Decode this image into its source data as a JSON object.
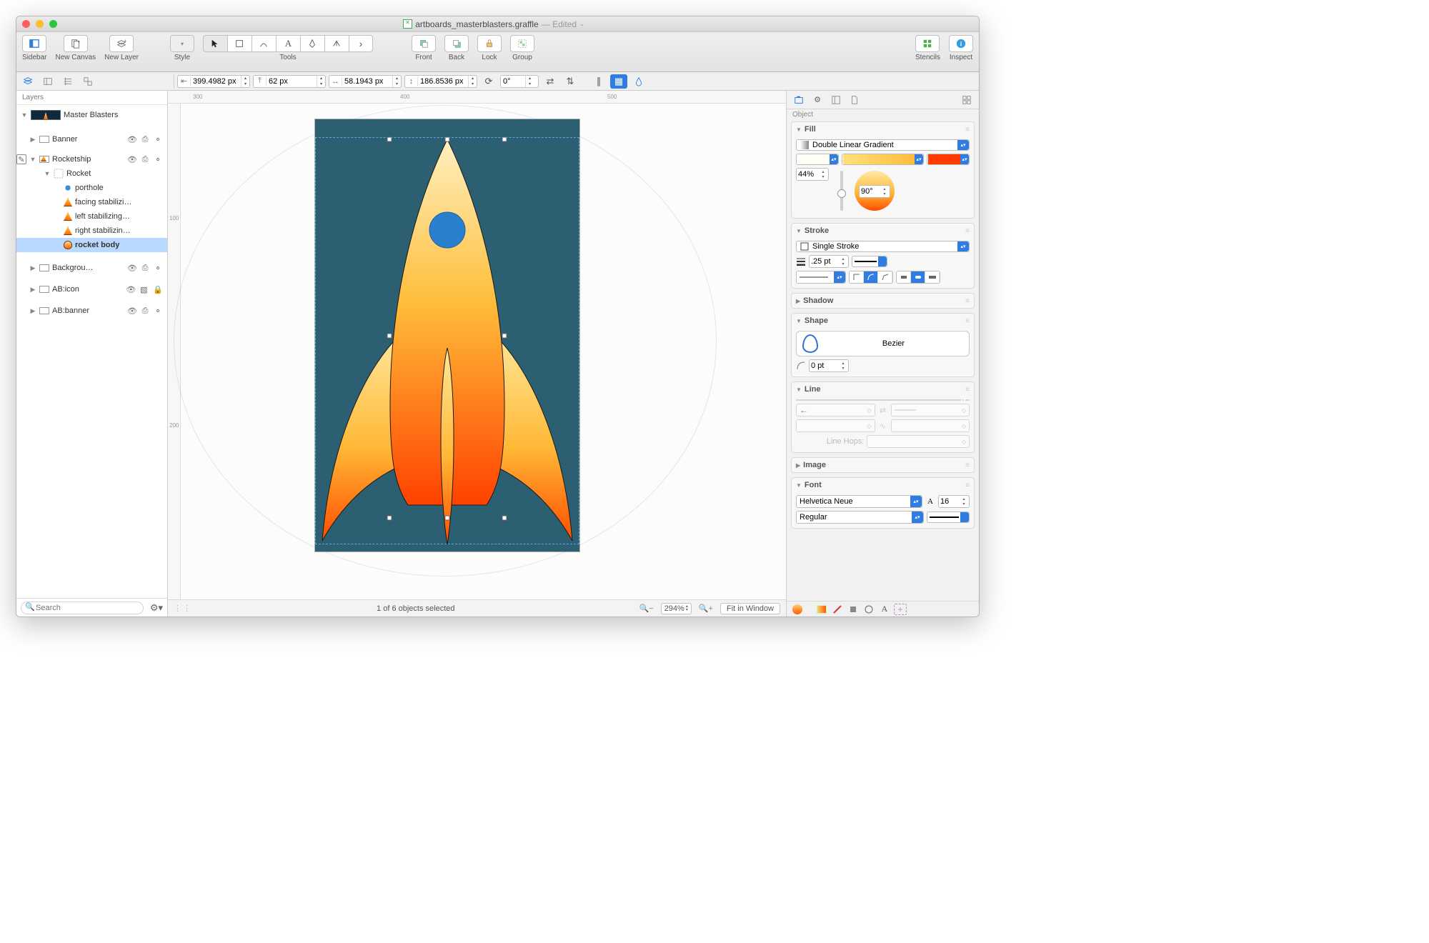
{
  "title": {
    "filename": "artboards_masterblasters.graffle",
    "status": "— Edited"
  },
  "toolbar": {
    "sidebar": "Sidebar",
    "new_canvas": "New Canvas",
    "new_layer": "New Layer",
    "style": "Style",
    "tools": "Tools",
    "front": "Front",
    "back": "Back",
    "lock": "Lock",
    "group": "Group",
    "stencils": "Stencils",
    "inspect": "Inspect"
  },
  "geom": {
    "x": "399.4982 px",
    "y": "62 px",
    "w": "58.1943 px",
    "h": "186.8536 px",
    "rot": "0°"
  },
  "sidebar": {
    "tab": "Layers",
    "search_ph": "Search",
    "canvas": "Master Blasters",
    "layers": [
      {
        "name": "Banner",
        "kind": "layer",
        "swatch": "swatch-empty",
        "expanded": false,
        "vis": true,
        "lock": false
      },
      {
        "name": "Rocketship",
        "kind": "layer",
        "swatch": "swatch-empty",
        "expanded": true,
        "vis": true,
        "lock": false,
        "edit": true,
        "children": [
          {
            "name": "Rocket",
            "kind": "group",
            "expanded": true,
            "children": [
              {
                "name": "porthole",
                "thumb": "rocket-thumb"
              },
              {
                "name": "facing stabilizi…",
                "thumb": "fin-thumb"
              },
              {
                "name": "left stabilizing…",
                "thumb": "fin-thumb"
              },
              {
                "name": "right stabilizin…",
                "thumb": "fin-thumb"
              },
              {
                "name": "rocket body",
                "thumb": "body-thumb",
                "selected": true
              }
            ]
          }
        ]
      },
      {
        "name": "Backgrou…",
        "kind": "layer",
        "swatch": "swatch-dark",
        "expanded": false,
        "vis": true,
        "lock": false
      },
      {
        "name": "AB:icon",
        "kind": "layer",
        "swatch": "swatch-pink",
        "expanded": false,
        "vis": true,
        "lock": true,
        "ab": true
      },
      {
        "name": "AB:banner",
        "kind": "layer",
        "swatch": "swatch-pink",
        "expanded": false,
        "vis": true,
        "lock": false,
        "ab": true
      }
    ]
  },
  "canvas": {
    "ruler_marks_h": [
      "300",
      "400",
      "500"
    ],
    "ruler_marks_v": [
      "100",
      "200"
    ],
    "status": "1 of 6 objects selected",
    "zoom": "294%",
    "fit": "Fit in Window"
  },
  "inspector": {
    "tab": "Object",
    "fill": {
      "label": "Fill",
      "type": "Double Linear Gradient",
      "midpoint": "44%",
      "angle": "90°"
    },
    "stroke": {
      "label": "Stroke",
      "type": "Single Stroke",
      "weight": ".25 pt"
    },
    "shadow": {
      "label": "Shadow"
    },
    "shape": {
      "label": "Shape",
      "type": "Bezier",
      "radius": "0 pt"
    },
    "line": {
      "label": "Line",
      "hops": "Line Hops:"
    },
    "image": {
      "label": "Image"
    },
    "font": {
      "label": "Font",
      "family": "Helvetica Neue",
      "size": "16",
      "weight": "Regular"
    }
  }
}
